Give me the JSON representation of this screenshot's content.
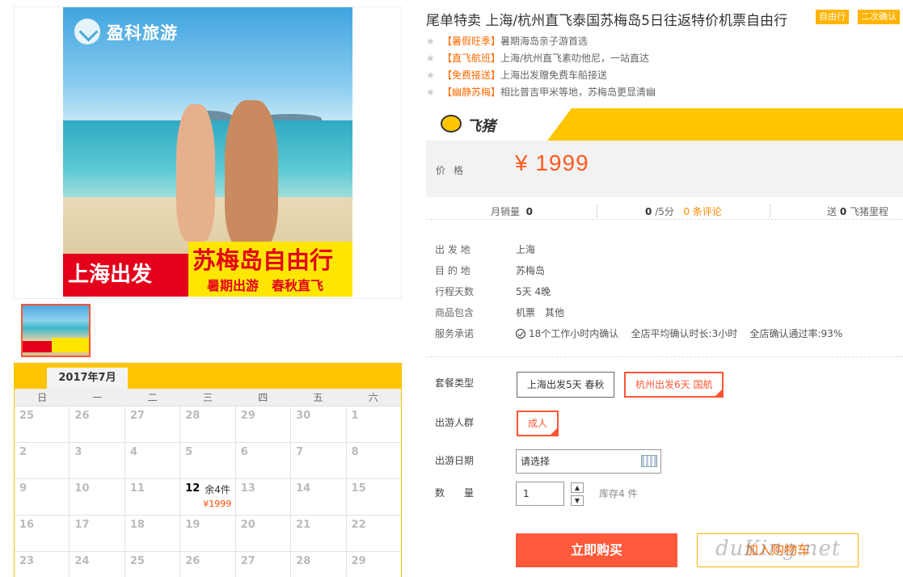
{
  "brand": {
    "logo_text": "盈科旅游"
  },
  "banner": {
    "left_text": "上海出发",
    "title": "苏梅岛自由行",
    "subtitle": "暑期出游　春秋直飞"
  },
  "calendar": {
    "month": "2017年7月",
    "weekdays": [
      "日",
      "一",
      "二",
      "三",
      "四",
      "五",
      "六"
    ],
    "rows": [
      [
        "25",
        "26",
        "27",
        "28",
        "29",
        "30",
        "1"
      ],
      [
        "2",
        "3",
        "4",
        "5",
        "6",
        "7",
        "8"
      ],
      [
        "9",
        "10",
        "11",
        "12",
        "13",
        "14",
        "15"
      ],
      [
        "16",
        "17",
        "18",
        "19",
        "20",
        "21",
        "22"
      ],
      [
        "23",
        "24",
        "25",
        "26",
        "27",
        "28",
        "29"
      ]
    ],
    "active_day": {
      "day": "12",
      "stock": "余4件",
      "price": "¥1999"
    }
  },
  "product": {
    "title": "尾单特卖 上海/杭州直飞泰国苏梅岛5日往返特价机票自由行",
    "tags": [
      "自由行",
      "二次确认"
    ],
    "features": [
      {
        "tag": "【暑假旺季】",
        "text": "暑期海岛亲子游首选"
      },
      {
        "tag": "【直飞航班】",
        "text": "上海/杭州直飞素叻他尼，一站直达"
      },
      {
        "tag": "【免费接送】",
        "text": "上海出发赠免费车船接送"
      },
      {
        "tag": "【幽静苏梅】",
        "text": "相比普吉甲米等地，苏梅岛更显清幽"
      }
    ]
  },
  "price_box": {
    "brand": "飞猪",
    "label": "价格",
    "price": "¥ 1999"
  },
  "stats": {
    "monthly_sales_label": "月销量",
    "monthly_sales": "0",
    "score": "0",
    "score_suffix": "/5分",
    "reviews": "0 条评论",
    "points_prefix": "送",
    "points": "0",
    "points_suffix": "飞猪里程"
  },
  "info": [
    {
      "label": "出 发 地",
      "value": "上海"
    },
    {
      "label": "目 的 地",
      "value": "苏梅岛"
    },
    {
      "label": "行程天数",
      "value": "5天 4晚"
    },
    {
      "label": "商品包含",
      "value": "机票　其他"
    }
  ],
  "service": {
    "label": "服务承诺",
    "items": [
      "18个工作小时内确认",
      "全店平均确认时长:3小时",
      "全店确认通过率:93%"
    ]
  },
  "options": {
    "package_label": "套餐类型",
    "packages": [
      "上海出发5天 春秋",
      "杭州出发6天 国航"
    ],
    "crowd_label": "出游人群",
    "crowd": "成人",
    "date_label": "出游日期",
    "date_placeholder": "请选择",
    "qty_label": "数　　量",
    "qty_value": "1",
    "stock": "库存4 件"
  },
  "actions": {
    "buy": "立即购买",
    "cart": "加入购物车"
  },
  "watermark": "duKing.net"
}
